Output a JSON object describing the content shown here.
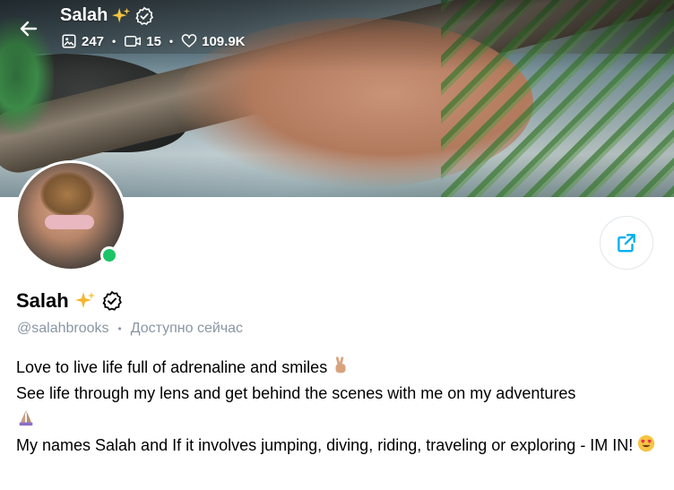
{
  "header": {
    "name": "Salah",
    "name_emoji": "sparkles-icon",
    "verified_icon": "verified-badge-icon",
    "stats": {
      "photos": "247",
      "videos": "15",
      "likes": "109.9K"
    }
  },
  "profile": {
    "name": "Salah",
    "handle": "@salahbrooks",
    "status": "Доступно сейчас",
    "online": true,
    "bio": [
      "Love to live life full of adrenaline and smiles",
      "See life through my lens and get behind the scenes with me on my adventures",
      "My names Salah and If it involves jumping, diving, riding, traveling or exploring - IM IN!"
    ]
  },
  "colors": {
    "accent": "#00aff0",
    "online": "#1bc468",
    "muted": "#8a96a3"
  }
}
